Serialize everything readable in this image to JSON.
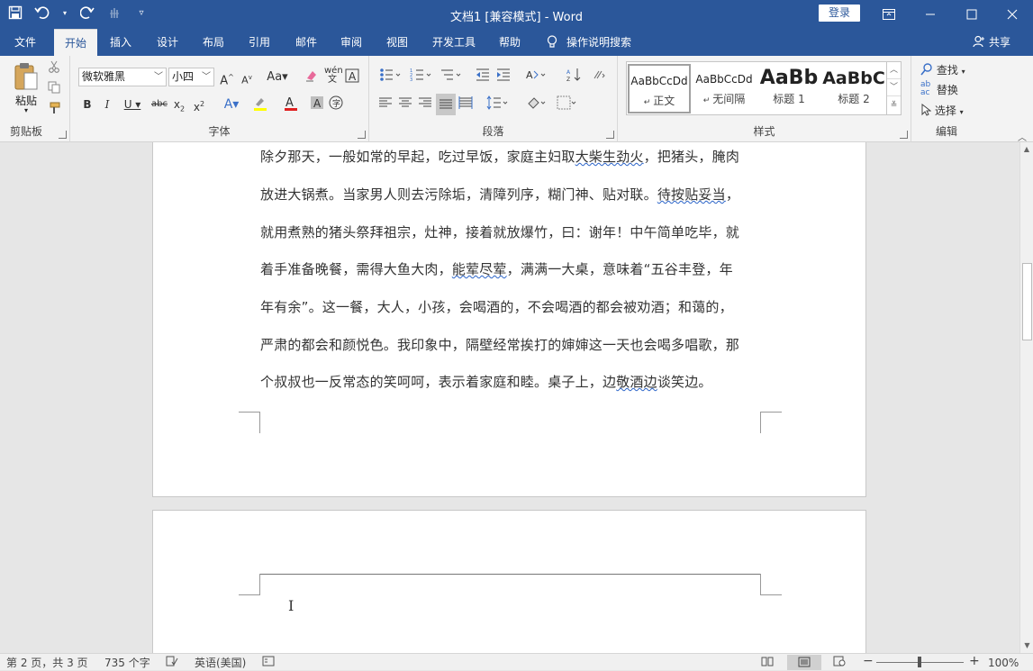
{
  "titlebar": {
    "doc_title": "文档1 [兼容模式] - Word",
    "login_label": "登录",
    "icons": [
      "save-icon",
      "undo-icon",
      "redo-icon",
      "touch-mode-icon",
      "customize-qat-icon"
    ]
  },
  "tabs": [
    "文件",
    "开始",
    "插入",
    "设计",
    "布局",
    "引用",
    "邮件",
    "审阅",
    "视图",
    "开发工具",
    "帮助"
  ],
  "active_tab": "开始",
  "tellme": "操作说明搜索",
  "share": "共享",
  "ribbon": {
    "clipboard": {
      "paste_label": "粘贴",
      "group_label": "剪贴板"
    },
    "font": {
      "font_name": "微软雅黑",
      "font_size": "小四",
      "group_label": "字体"
    },
    "paragraph": {
      "group_label": "段落"
    },
    "styles": {
      "group_label": "样式",
      "items": [
        {
          "preview": "AaBbCcDd",
          "name": "正文"
        },
        {
          "preview": "AaBbCcDd",
          "name": "无间隔"
        },
        {
          "preview": "AaBb",
          "name": "标题 1"
        },
        {
          "preview": "AaBbC",
          "name": "标题 2"
        }
      ]
    },
    "editing": {
      "find": "查找",
      "replace": "替换",
      "select": "选择",
      "group_label": "编辑"
    }
  },
  "document": {
    "lines": [
      "除夕那天，一般如常的早起，吃过早饭，家庭主妇取大柴生劲火，把猪头，腌肉",
      "放进大锅煮。当家男人则去污除垢，清障列序，糊门神、贴对联。待按贴妥当，",
      "就用煮熟的猪头祭拜祖宗，灶神，接着就放爆竹，曰：谢年！中午简单吃毕，就",
      "着手准备晚餐，需得大鱼大肉，能荤尽荤，满满一大桌，意味着“五谷丰登，年",
      "年有余”。这一餐，大人，小孩，会喝酒的，不会喝酒的都会被劝酒；和蔼的，",
      "严肃的都会和颜悦色。我印象中，隔壁经常挨打的婶婶这一天也会喝多唱歌，那",
      "个叔叔也一反常态的笑呵呵，表示着家庭和睦。桌子上，边敬酒边谈笑边。"
    ]
  },
  "statusbar": {
    "page": "第 2 页，共 3 页",
    "words": "735 个字",
    "language": "英语(美国)",
    "zoom": "100%"
  }
}
